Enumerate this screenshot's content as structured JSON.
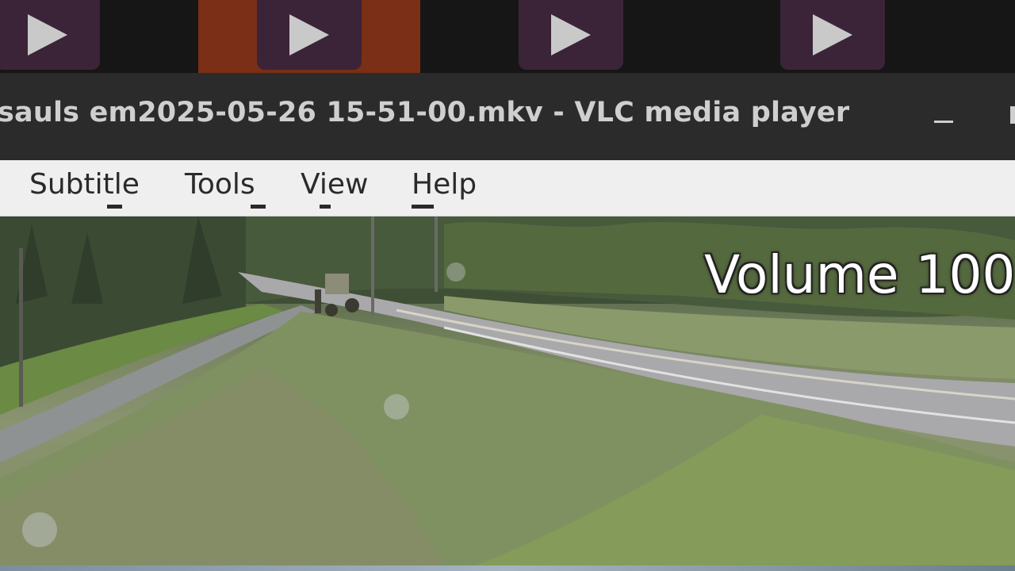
{
  "taskbar": {
    "items": [
      {
        "name": "taskbar-app-1",
        "active": false
      },
      {
        "name": "taskbar-app-2",
        "active": true
      },
      {
        "name": "taskbar-app-3",
        "active": false
      },
      {
        "name": "taskbar-app-4",
        "active": false
      }
    ],
    "icon": "play-icon"
  },
  "window": {
    "title": "sauls em2025-05-26 15-51-00.mkv - VLC media player",
    "minimize_label": "_"
  },
  "menu": {
    "subtitle": "Subtitle",
    "tools": "Tools",
    "view": "View",
    "help": "Help"
  },
  "video": {
    "osd": "Volume 100"
  },
  "colors": {
    "taskbar_bg": "#161616",
    "active_task": "#7a2f16",
    "tile": "#3b2438",
    "titlebar": "#2b2b2b",
    "menubar": "#efefef"
  }
}
